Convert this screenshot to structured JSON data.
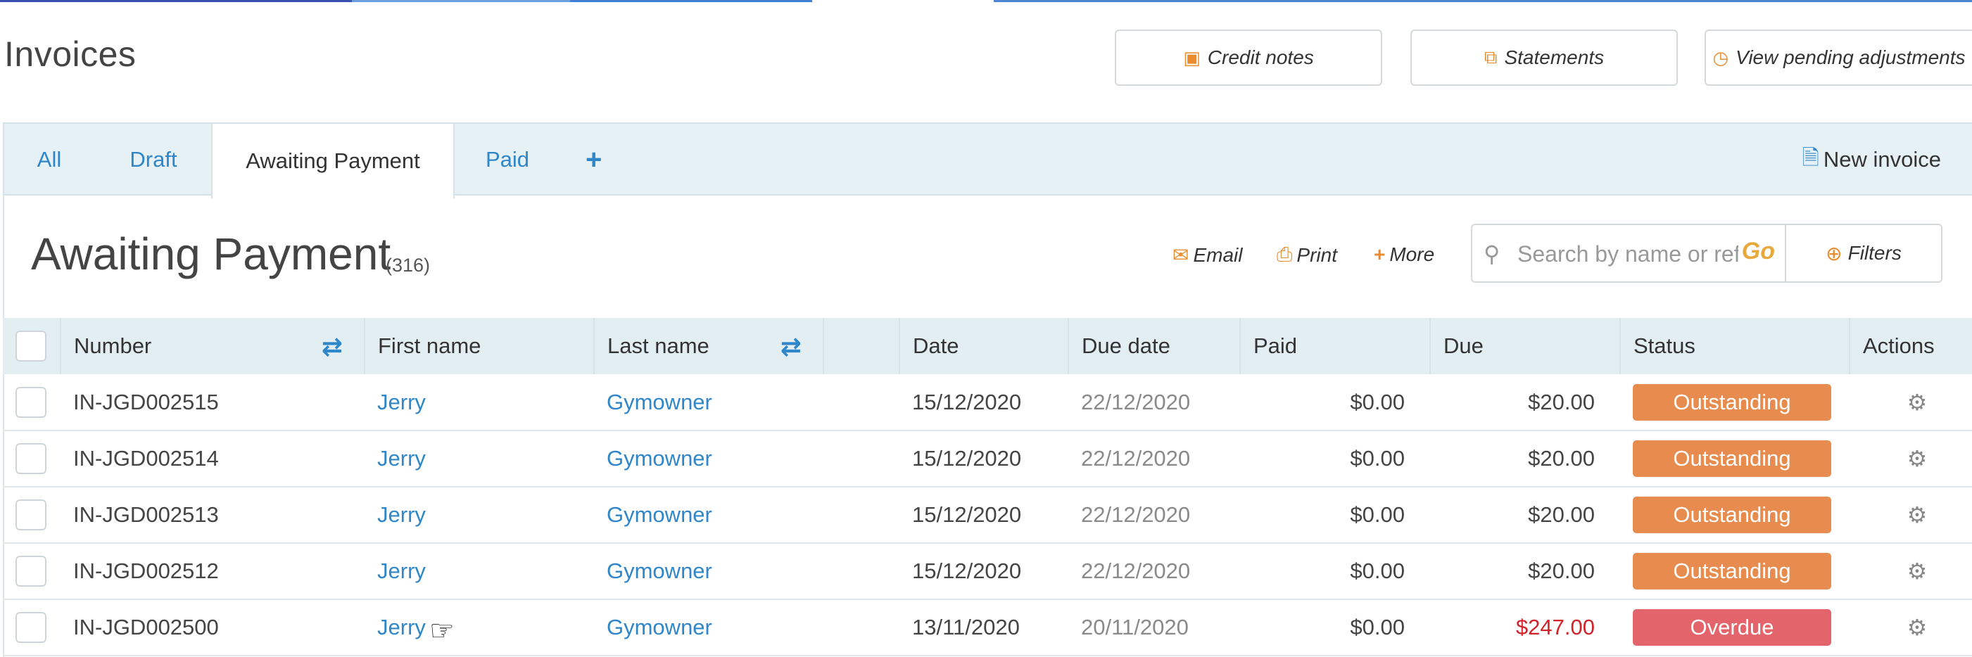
{
  "page": {
    "title": "Invoices",
    "accent": "#2f86c9",
    "orange": "#ea8b2d"
  },
  "top_buttons": [
    {
      "label": "Credit notes",
      "icon": "cash-icon"
    },
    {
      "label": "Statements",
      "icon": "copy-icon"
    },
    {
      "label": "View pending adjustments",
      "icon": "clock-icon"
    }
  ],
  "tabs": [
    {
      "label": "All"
    },
    {
      "label": "Draft"
    },
    {
      "label": "Awaiting Payment",
      "active": true
    },
    {
      "label": "Paid"
    }
  ],
  "new_invoice_label": "New invoice",
  "section": {
    "title": "Awaiting Payment",
    "count": "(316)"
  },
  "actions": {
    "email": "Email",
    "print": "Print",
    "more": "More"
  },
  "search": {
    "placeholder": "Search by name or ref",
    "go": "Go",
    "filters": "Filters"
  },
  "table": {
    "headers": {
      "number": "Number",
      "first_name": "First name",
      "last_name": "Last name",
      "blank": "",
      "date": "Date",
      "due_date": "Due date",
      "paid": "Paid",
      "due": "Due",
      "status": "Status",
      "actions": "Actions"
    },
    "rows": [
      {
        "number": "IN-JGD002515",
        "first_name": "Jerry",
        "last_name": "Gymowner",
        "date": "15/12/2020",
        "due_date": "22/12/2020",
        "paid": "$0.00",
        "due": "$20.00",
        "status": "Outstanding"
      },
      {
        "number": "IN-JGD002514",
        "first_name": "Jerry",
        "last_name": "Gymowner",
        "date": "15/12/2020",
        "due_date": "22/12/2020",
        "paid": "$0.00",
        "due": "$20.00",
        "status": "Outstanding"
      },
      {
        "number": "IN-JGD002513",
        "first_name": "Jerry",
        "last_name": "Gymowner",
        "date": "15/12/2020",
        "due_date": "22/12/2020",
        "paid": "$0.00",
        "due": "$20.00",
        "status": "Outstanding"
      },
      {
        "number": "IN-JGD002512",
        "first_name": "Jerry",
        "last_name": "Gymowner",
        "date": "15/12/2020",
        "due_date": "22/12/2020",
        "paid": "$0.00",
        "due": "$20.00",
        "status": "Outstanding"
      },
      {
        "number": "IN-JGD002500",
        "first_name": "Jerry",
        "last_name": "Gymowner",
        "date": "13/11/2020",
        "due_date": "20/11/2020",
        "paid": "$0.00",
        "due": "$247.00",
        "status": "Overdue"
      }
    ]
  }
}
